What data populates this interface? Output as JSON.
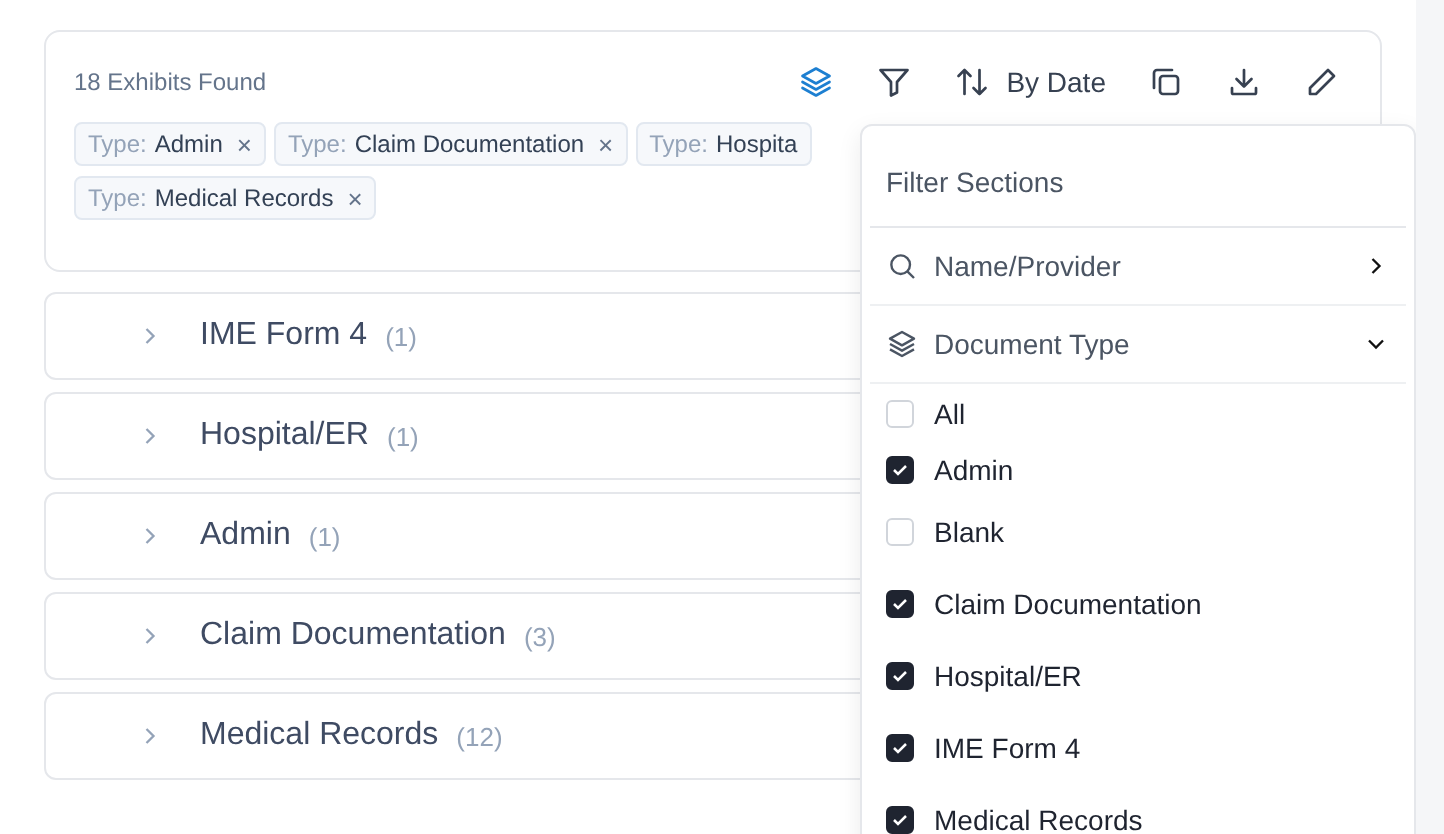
{
  "summary": {
    "count_text": "18 Exhibits Found",
    "sort_label": "By Date"
  },
  "tags": [
    {
      "prefix": "Type:",
      "value": "Admin",
      "close": "×"
    },
    {
      "prefix": "Type:",
      "value": "Claim Documentation",
      "close": "×"
    },
    {
      "prefix": "Type:",
      "value": "Hospita"
    },
    {
      "prefix": "Type:",
      "value": "Medical Records",
      "close": "×"
    }
  ],
  "sections": [
    {
      "title": "IME Form 4",
      "count": "(1)"
    },
    {
      "title": "Hospital/ER",
      "count": "(1)"
    },
    {
      "title": "Admin",
      "count": "(1)"
    },
    {
      "title": "Claim Documentation",
      "count": "(3)"
    },
    {
      "title": "Medical Records",
      "count": "(12)"
    }
  ],
  "filter_menu": {
    "title": "Filter Sections",
    "groups": [
      {
        "kind": "search",
        "label": "Name/Provider",
        "expanded": false
      },
      {
        "kind": "layers",
        "label": "Document Type",
        "expanded": true
      }
    ],
    "options": [
      {
        "label": "All",
        "checked": false
      },
      {
        "label": "Admin",
        "checked": true
      },
      {
        "label": "Blank",
        "checked": false
      },
      {
        "label": "Claim Documentation",
        "checked": true
      },
      {
        "label": "Hospital/ER",
        "checked": true
      },
      {
        "label": "IME Form 4",
        "checked": true
      },
      {
        "label": "Medical Records",
        "checked": true
      }
    ]
  }
}
